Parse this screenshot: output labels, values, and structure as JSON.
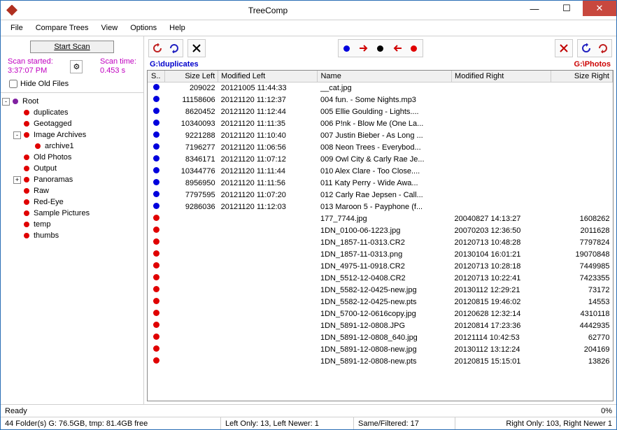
{
  "window": {
    "title": "TreeComp"
  },
  "menu": {
    "file": "File",
    "compare": "Compare Trees",
    "view": "View",
    "options": "Options",
    "help": "Help"
  },
  "scan": {
    "button": "Start Scan",
    "started_label": "Scan started:",
    "started_time": "3:37:07 PM",
    "duration_label": "Scan time:",
    "duration": "0.453 s",
    "hide_old": "Hide Old Files"
  },
  "paths": {
    "left": "G:\\duplicates",
    "right": "G:\\Photos"
  },
  "tree": {
    "root": "Root",
    "items": [
      {
        "label": "duplicates",
        "depth": 1
      },
      {
        "label": "Geotagged",
        "depth": 1
      },
      {
        "label": "Image Archives",
        "depth": 1,
        "expand": "-"
      },
      {
        "label": "archive1",
        "depth": 2
      },
      {
        "label": "Old Photos",
        "depth": 1
      },
      {
        "label": "Output",
        "depth": 1
      },
      {
        "label": "Panoramas",
        "depth": 1,
        "expand": "+"
      },
      {
        "label": "Raw",
        "depth": 1
      },
      {
        "label": "Red-Eye",
        "depth": 1
      },
      {
        "label": "Sample Pictures",
        "depth": 1
      },
      {
        "label": "temp",
        "depth": 1
      },
      {
        "label": "thumbs",
        "depth": 1
      }
    ]
  },
  "columns": {
    "status": "S..",
    "size_left": "Size Left",
    "mod_left": "Modified Left",
    "name": "Name",
    "mod_right": "Modified Right",
    "size_right": "Size Right"
  },
  "rows": [
    {
      "c": "blue",
      "sl": "209022",
      "ml": "20121005 11:44:33",
      "n": "__cat.jpg",
      "mr": "",
      "sr": ""
    },
    {
      "c": "blue",
      "sl": "11158606",
      "ml": "20121120 11:12:37",
      "n": "004 fun. - Some Nights.mp3",
      "mr": "",
      "sr": ""
    },
    {
      "c": "blue",
      "sl": "8620452",
      "ml": "20121120 11:12:44",
      "n": "005 Ellie Goulding - Lights....",
      "mr": "",
      "sr": ""
    },
    {
      "c": "blue",
      "sl": "10340093",
      "ml": "20121120 11:11:35",
      "n": "006 P!nk - Blow Me (One La...",
      "mr": "",
      "sr": ""
    },
    {
      "c": "blue",
      "sl": "9221288",
      "ml": "20121120 11:10:40",
      "n": "007 Justin Bieber - As Long ...",
      "mr": "",
      "sr": ""
    },
    {
      "c": "blue",
      "sl": "7196277",
      "ml": "20121120 11:06:56",
      "n": "008 Neon Trees - Everybod...",
      "mr": "",
      "sr": ""
    },
    {
      "c": "blue",
      "sl": "8346171",
      "ml": "20121120 11:07:12",
      "n": "009 Owl City & Carly Rae Je...",
      "mr": "",
      "sr": ""
    },
    {
      "c": "blue",
      "sl": "10344776",
      "ml": "20121120 11:11:44",
      "n": "010 Alex Clare - Too Close....",
      "mr": "",
      "sr": ""
    },
    {
      "c": "blue",
      "sl": "8956950",
      "ml": "20121120 11:11:56",
      "n": "011 Katy Perry - Wide Awa...",
      "mr": "",
      "sr": ""
    },
    {
      "c": "blue",
      "sl": "7797595",
      "ml": "20121120 11:07:20",
      "n": "012 Carly Rae Jepsen - Call...",
      "mr": "",
      "sr": ""
    },
    {
      "c": "blue",
      "sl": "9286036",
      "ml": "20121120 11:12:03",
      "n": "013 Maroon 5 - Payphone (f...",
      "mr": "",
      "sr": ""
    },
    {
      "c": "red",
      "sl": "",
      "ml": "",
      "n": "177_7744.jpg",
      "mr": "20040827 14:13:27",
      "sr": "1608262"
    },
    {
      "c": "red",
      "sl": "",
      "ml": "",
      "n": "1DN_0100-06-1223.jpg",
      "mr": "20070203 12:36:50",
      "sr": "2011628"
    },
    {
      "c": "red",
      "sl": "",
      "ml": "",
      "n": "1DN_1857-11-0313.CR2",
      "mr": "20120713 10:48:28",
      "sr": "7797824"
    },
    {
      "c": "red",
      "sl": "",
      "ml": "",
      "n": "1DN_1857-11-0313.png",
      "mr": "20130104 16:01:21",
      "sr": "19070848"
    },
    {
      "c": "red",
      "sl": "",
      "ml": "",
      "n": "1DN_4975-11-0918.CR2",
      "mr": "20120713 10:28:18",
      "sr": "7449985"
    },
    {
      "c": "red",
      "sl": "",
      "ml": "",
      "n": "1DN_5512-12-0408.CR2",
      "mr": "20120713 10:22:41",
      "sr": "7423355"
    },
    {
      "c": "red",
      "sl": "",
      "ml": "",
      "n": "1DN_5582-12-0425-new.jpg",
      "mr": "20130112 12:29:21",
      "sr": "73172"
    },
    {
      "c": "red",
      "sl": "",
      "ml": "",
      "n": "1DN_5582-12-0425-new.pts",
      "mr": "20120815 19:46:02",
      "sr": "14553"
    },
    {
      "c": "red",
      "sl": "",
      "ml": "",
      "n": "1DN_5700-12-0616copy.jpg",
      "mr": "20120628 12:32:14",
      "sr": "4310118"
    },
    {
      "c": "red",
      "sl": "",
      "ml": "",
      "n": "1DN_5891-12-0808.JPG",
      "mr": "20120814 17:23:36",
      "sr": "4442935"
    },
    {
      "c": "red",
      "sl": "",
      "ml": "",
      "n": "1DN_5891-12-0808_640.jpg",
      "mr": "20121114 10:42:53",
      "sr": "62770"
    },
    {
      "c": "red",
      "sl": "",
      "ml": "",
      "n": "1DN_5891-12-0808-new.jpg",
      "mr": "20130112 13:12:24",
      "sr": "204169"
    },
    {
      "c": "red",
      "sl": "",
      "ml": "",
      "n": "1DN_5891-12-0808-new.pts",
      "mr": "20120815 15:15:01",
      "sr": "13826"
    }
  ],
  "status": {
    "ready": "Ready",
    "progress": "0%",
    "folders": "44 Folder(s) G: 76.5GB, tmp: 81.4GB free",
    "left_only": "Left Only: 13, Left Newer: 1",
    "same": "Same/Filtered: 17",
    "right_only": "Right Only: 103, Right Newer 1"
  }
}
